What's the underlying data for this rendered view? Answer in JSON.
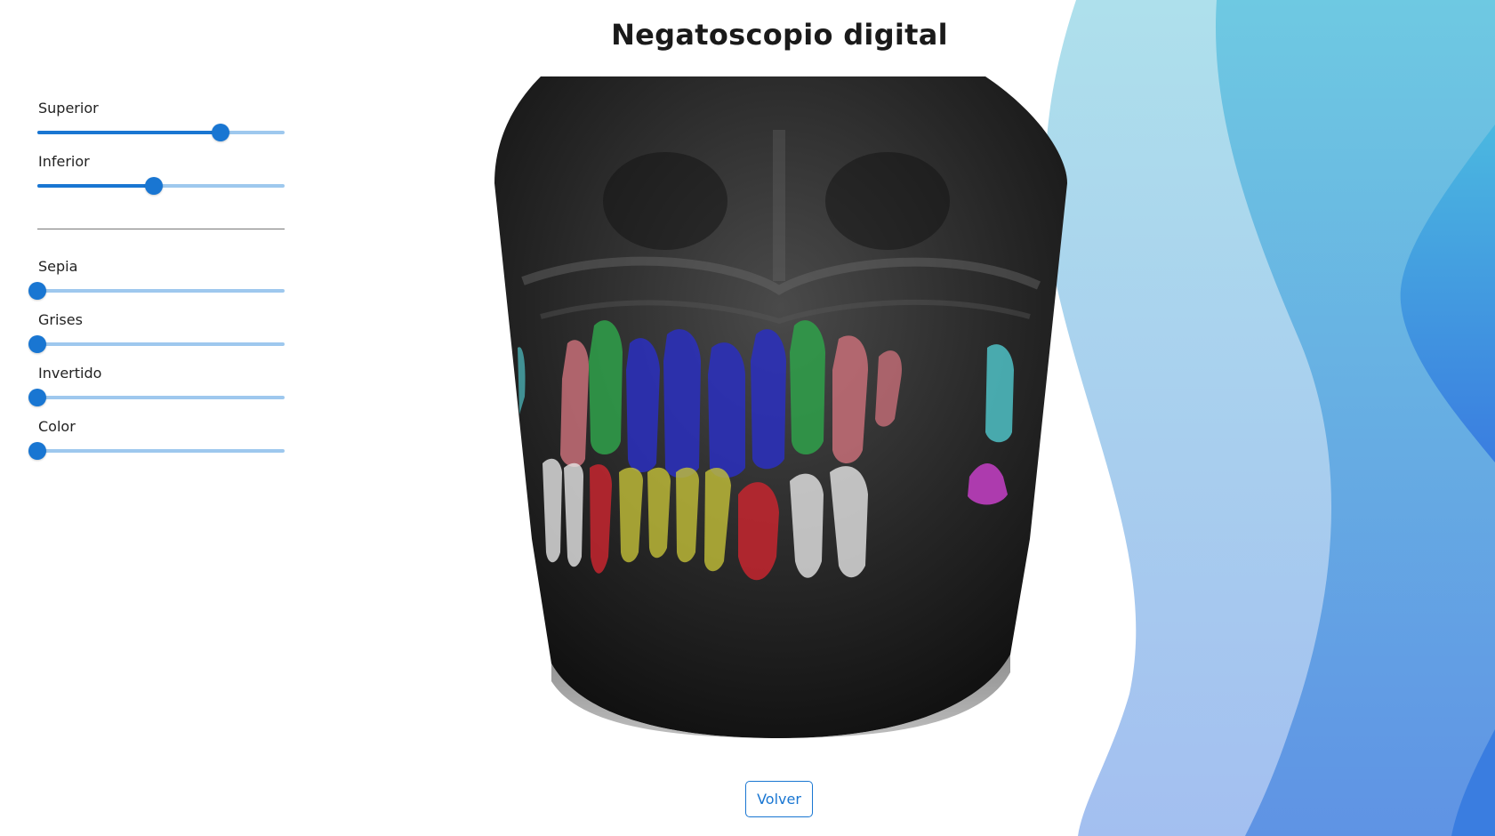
{
  "page": {
    "title": "Negatoscopio digital"
  },
  "colors": {
    "accent": "#1976d2",
    "slider_track": "#9ec8ee",
    "wave_light": "#a7dbea",
    "wave_mid": "#6fc0e0",
    "wave_deep": "#3b82e0"
  },
  "controls": {
    "superior": {
      "label": "Superior",
      "value_percent": 74
    },
    "inferior": {
      "label": "Inferior",
      "value_percent": 47
    },
    "sepia": {
      "label": "Sepia",
      "value_percent": 0
    },
    "grises": {
      "label": "Grises",
      "value_percent": 0
    },
    "invertido": {
      "label": "Invertido",
      "value_percent": 0
    },
    "color": {
      "label": "Color",
      "value_percent": 0
    }
  },
  "image": {
    "description_icon": "dental-panoramic-xray"
  },
  "actions": {
    "back_label": "Volver"
  }
}
